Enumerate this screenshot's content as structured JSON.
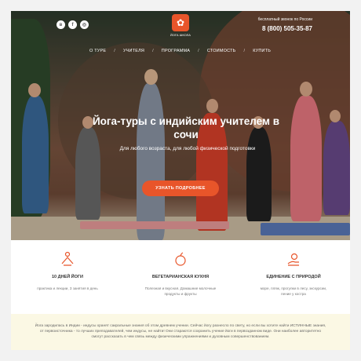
{
  "header": {
    "social": [
      {
        "icon": "vk-icon",
        "glyph": "в"
      },
      {
        "icon": "facebook-icon",
        "glyph": "f"
      },
      {
        "icon": "instagram-icon",
        "glyph": "◎"
      }
    ],
    "logo_text": "ЙОГА ШКОЛА",
    "call_note": "бесплатный звонок по России",
    "phone": "8 (800) 505-35-87"
  },
  "nav": {
    "items": [
      "О ТУРЕ",
      "УЧИТЕЛЯ",
      "ПРОГРАММА",
      "СТОИМОСТЬ",
      "КУПИТЬ"
    ],
    "separator": "/"
  },
  "hero": {
    "headline": "Йога-туры с индийским учителем в сочи",
    "subtitle": "Для любого возраста, для любой физической подготовки",
    "cta_label": "УЗНАТЬ ПОДРОБНЕЕ"
  },
  "features": [
    {
      "icon": "meditation-icon",
      "title": "10 ДНЕЙ ЙОГИ",
      "desc": "практика и лекции, 3 занятия в день"
    },
    {
      "icon": "apple-icon",
      "title": "ВЕГЕТАРИАНСКАЯ КУХНЯ",
      "desc": "Полезная и вкусная. Домашние молочные продукты и фрукты"
    },
    {
      "icon": "sun-hand-icon",
      "title": "ЕДИНЕНИЕ С ПРИРОДОЙ",
      "desc": "море, пляж, прогулки в лесу, экскурсии, пение у костра"
    }
  ],
  "story": {
    "text": "Йога зародилась в Индии - индусы хранят сакральные знания об этом древнем учении. Сейчас йогу разнесло по свету, но если вы хотите найти ИСТИННЫЕ знания, от первоисточника - то лучших преподавателей, чем индусы, не найти! Они стараются сохранить учение йоги в первозданном виде. Они наиболее авторитетно смогут рассказать в чем связь между физическими упражнениями и духовным совершенствованием."
  },
  "colors": {
    "accent": "#e8552a",
    "story_bg": "#fbf8e4"
  }
}
